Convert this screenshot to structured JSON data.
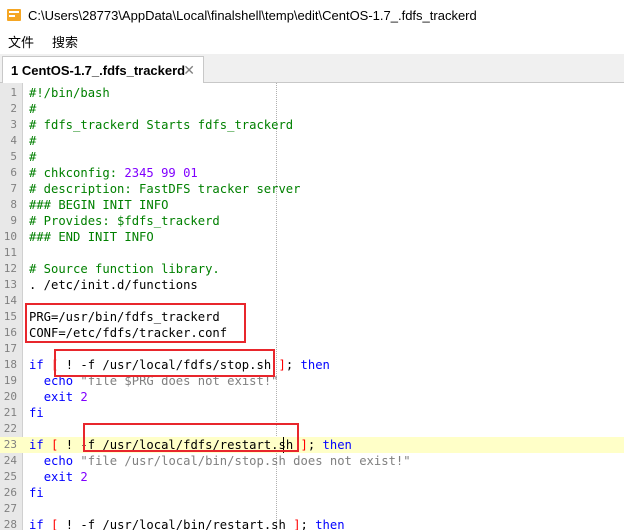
{
  "window": {
    "title": "C:\\Users\\28773\\AppData\\Local\\finalshell\\temp\\edit\\CentOS-1.7_.fdfs_trackerd"
  },
  "menu": {
    "items": [
      "文件",
      "搜索"
    ]
  },
  "tabs": [
    {
      "label": "1 CentOS-1.7_.fdfs_trackerd",
      "close": "✕"
    }
  ],
  "editor": {
    "lines": [
      {
        "n": "1",
        "t": "#!/bin/bash"
      },
      {
        "n": "2",
        "t": "#"
      },
      {
        "n": "3",
        "t": "# fdfs_trackerd Starts fdfs_trackerd"
      },
      {
        "n": "4",
        "t": "#"
      },
      {
        "n": "5",
        "t": "#"
      },
      {
        "n": "6",
        "t": "# chkconfig: 2345 99 01"
      },
      {
        "n": "7",
        "t": "# description: FastDFS tracker server"
      },
      {
        "n": "8",
        "t": "### BEGIN INIT INFO"
      },
      {
        "n": "9",
        "t": "# Provides: $fdfs_trackerd"
      },
      {
        "n": "10",
        "t": "### END INIT INFO"
      },
      {
        "n": "11",
        "t": ""
      },
      {
        "n": "12",
        "t": "# Source function library."
      },
      {
        "n": "13",
        "t": ". /etc/init.d/functions"
      },
      {
        "n": "14",
        "t": ""
      },
      {
        "n": "15",
        "t": "PRG=/usr/bin/fdfs_trackerd"
      },
      {
        "n": "16",
        "t": "CONF=/etc/fdfs/tracker.conf"
      },
      {
        "n": "17",
        "t": ""
      },
      {
        "n": "18",
        "t": "if [ ! -f /usr/local/fdfs/stop.sh ]; then"
      },
      {
        "n": "19",
        "t": "  echo \"file $PRG does not exist!\""
      },
      {
        "n": "20",
        "t": "  exit 2"
      },
      {
        "n": "21",
        "t": "fi"
      },
      {
        "n": "22",
        "t": ""
      },
      {
        "n": "23",
        "t": "if [ ! -f /usr/local/fdfs/restart.sh ]; then"
      },
      {
        "n": "24",
        "t": "  echo \"file /usr/local/bin/stop.sh does not exist!\""
      },
      {
        "n": "25",
        "t": "  exit 2"
      },
      {
        "n": "26",
        "t": "fi"
      },
      {
        "n": "27",
        "t": ""
      },
      {
        "n": "28",
        "t": "if [ ! -f /usr/local/bin/restart.sh ]; then"
      }
    ]
  },
  "colors": {
    "comment": "#008000",
    "keyword": "#0000ff",
    "number": "#8000ff",
    "string": "#808080",
    "current_line": "#ffffc8",
    "annotation_box": "#e8262c"
  },
  "icons": {
    "app": "finalshell-app-icon",
    "close": "close-icon"
  }
}
